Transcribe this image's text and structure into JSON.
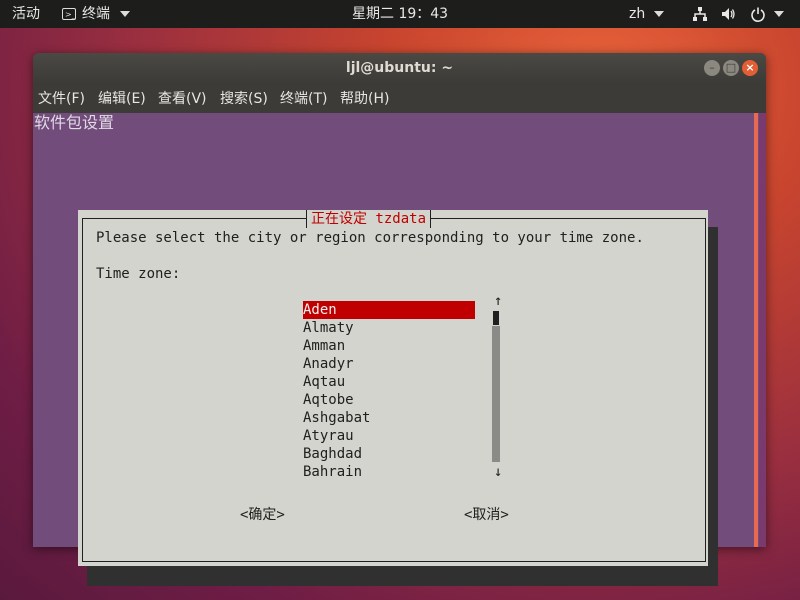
{
  "topbar": {
    "activities": "活动",
    "app_name": "终端",
    "clock": "星期二 19：43",
    "lang": "zh",
    "icons": [
      "network-icon",
      "volume-icon",
      "power-icon"
    ]
  },
  "window": {
    "title": "ljl@ubuntu: ~",
    "menu": [
      "文件(F)",
      "编辑(E)",
      "查看(V)",
      "搜索(S)",
      "终端(T)",
      "帮助(H)"
    ],
    "terminal_header": "软件包设置"
  },
  "dialog": {
    "title": "正在设定 tzdata",
    "prompt": "Please select the city or region corresponding to your time zone.",
    "label": "Time zone:",
    "items": [
      "Aden",
      "Almaty",
      "Amman",
      "Anadyr",
      "Aqtau",
      "Aqtobe",
      "Ashgabat",
      "Atyrau",
      "Baghdad",
      "Bahrain"
    ],
    "selected_index": 0,
    "scroll_up": "↑",
    "scroll_down": "↓",
    "ok_button": "<确定>",
    "cancel_button": "<取消>"
  },
  "colors": {
    "accent": "#c00000",
    "dialog_bg": "#d3d4cd",
    "terminal_bg": "#724d7c",
    "close_button": "#e35e34"
  }
}
